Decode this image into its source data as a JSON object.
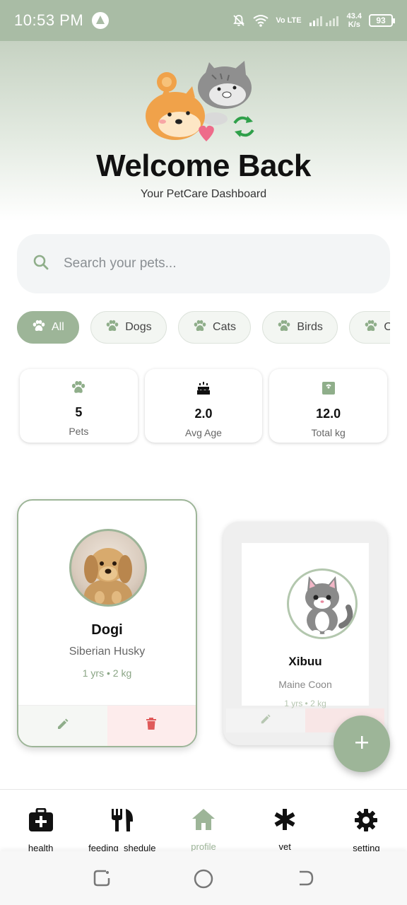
{
  "status_bar": {
    "time": "10:53 PM",
    "network": "Vo LTE",
    "speed_value": "43.4",
    "speed_unit": "K/s",
    "battery": "93"
  },
  "header": {
    "title": "Welcome Back",
    "subtitle": "Your PetCare Dashboard"
  },
  "search": {
    "placeholder": "Search your pets...",
    "value": ""
  },
  "filters": [
    {
      "label": "All",
      "active": true
    },
    {
      "label": "Dogs",
      "active": false
    },
    {
      "label": "Cats",
      "active": false
    },
    {
      "label": "Birds",
      "active": false
    },
    {
      "label": "Oth",
      "active": false
    }
  ],
  "stats": [
    {
      "value": "5",
      "label": "Pets",
      "icon": "paw-icon"
    },
    {
      "value": "2.0",
      "label": "Avg Age",
      "icon": "cake-icon"
    },
    {
      "value": "12.0",
      "label": "Total kg",
      "icon": "scale-icon"
    }
  ],
  "pets": [
    {
      "name": "Dogi",
      "breed": "Siberian Husky",
      "meta": "1 yrs • 2 kg"
    },
    {
      "name": "Xibuu",
      "breed": "Maine Coon",
      "meta": "1 yrs • 2 kg"
    }
  ],
  "bottom_nav": [
    {
      "label": "health",
      "icon": "medical-kit-icon",
      "active": false
    },
    {
      "label": "feeding_shedule",
      "icon": "fork-knife-icon",
      "active": false
    },
    {
      "label": "profile",
      "icon": "home-icon",
      "active": true
    },
    {
      "label": "vet",
      "icon": "asterisk-icon",
      "active": false
    },
    {
      "label": "setting",
      "icon": "gear-icon",
      "active": false
    }
  ],
  "colors": {
    "accent": "#9db598",
    "status_bar": "#a9bca5",
    "delete": "#e05a5a"
  }
}
